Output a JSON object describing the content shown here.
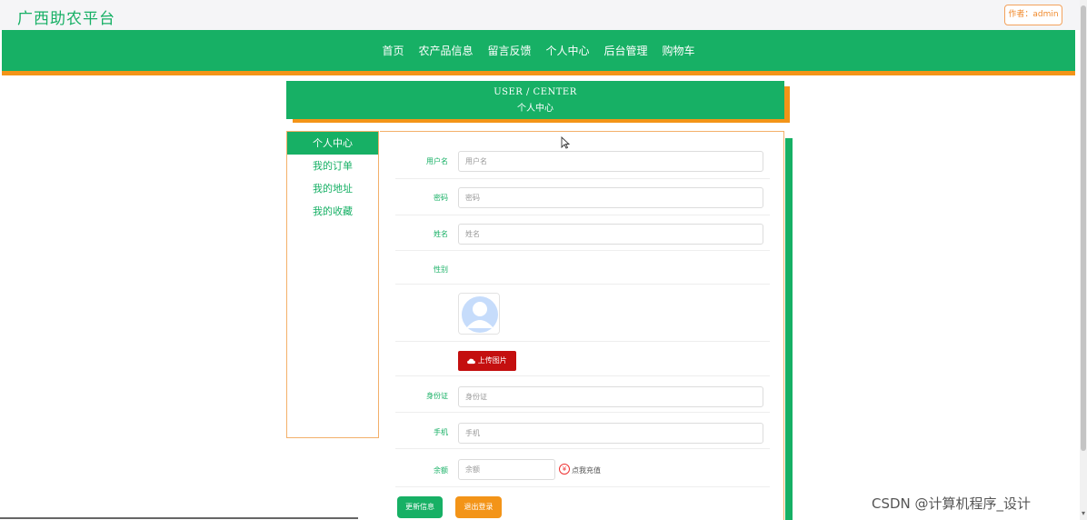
{
  "site": {
    "title": "广西助农平台",
    "author": "作者：admin"
  },
  "nav": {
    "items": [
      "首页",
      "农产品信息",
      "留言反馈",
      "个人中心",
      "后台管理",
      "购物车"
    ]
  },
  "header": {
    "en": "USER / CENTER",
    "cn": "个人中心"
  },
  "sidebar": {
    "items": [
      "个人中心",
      "我的订单",
      "我的地址",
      "我的收藏"
    ]
  },
  "form": {
    "username": {
      "label": "用户名",
      "placeholder": "用户名"
    },
    "password": {
      "label": "密码",
      "placeholder": "密码"
    },
    "name": {
      "label": "姓名",
      "placeholder": "姓名"
    },
    "gender": {
      "label": "性别"
    },
    "upload": {
      "label": "上传图片"
    },
    "idcard": {
      "label": "身份证",
      "placeholder": "身份证"
    },
    "phone": {
      "label": "手机",
      "placeholder": "手机"
    },
    "balance": {
      "label": "余额",
      "placeholder": "余额",
      "recharge": "点我充值",
      "recharge_icon": "¥"
    }
  },
  "buttons": {
    "update": "更新信息",
    "logout": "退出登录"
  },
  "watermark": "CSDN @计算机程序_设计",
  "colors": {
    "primary": "#17b065",
    "accent": "#f39418",
    "upload": "#c40f0f"
  }
}
